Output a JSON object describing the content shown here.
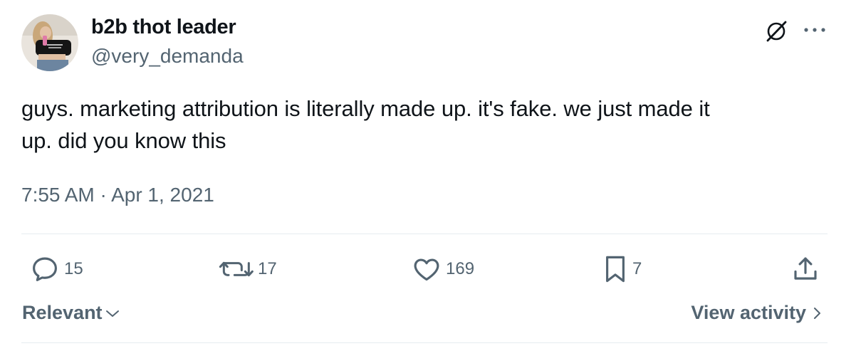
{
  "author": {
    "display_name": "b2b thot leader",
    "handle": "@very_demanda",
    "avatar_icon": "profile-photo"
  },
  "header_icons": [
    "grok-icon",
    "more-icon"
  ],
  "tweet": {
    "text": "guys. marketing attribution is literally made up. it's fake. we just made it\nup. did you know this",
    "timestamp": "7:55 AM · Apr 1, 2021"
  },
  "actions": {
    "replies": "15",
    "reposts": "17",
    "likes": "169",
    "bookmarks": "7"
  },
  "footer": {
    "sort_label": "Relevant",
    "view_activity_label": "View activity"
  },
  "colors": {
    "text": "#0f1419",
    "secondary": "#536471",
    "divider": "#e6ecf0"
  }
}
